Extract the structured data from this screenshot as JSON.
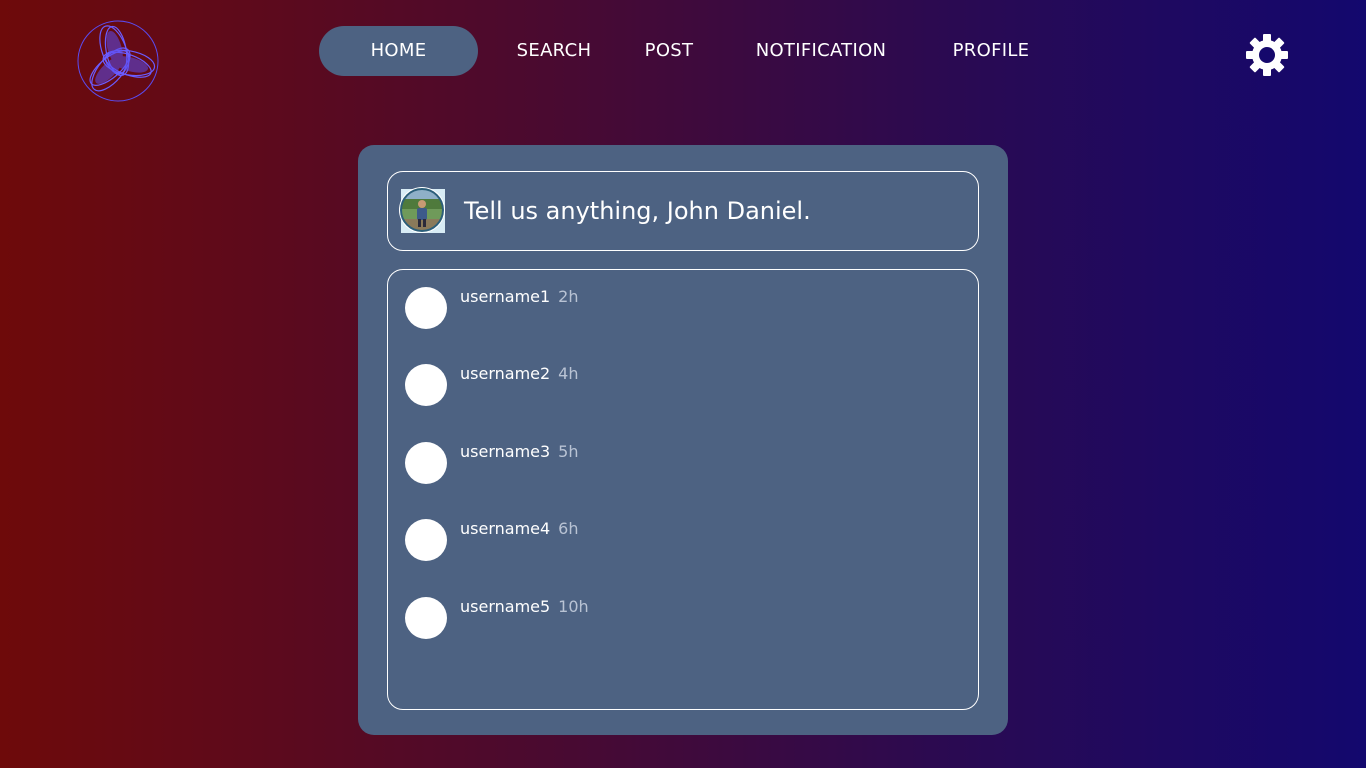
{
  "nav": {
    "items": [
      {
        "label": "HOME",
        "active": true
      },
      {
        "label": "SEARCH",
        "active": false
      },
      {
        "label": "POST",
        "active": false
      },
      {
        "label": "NOTIFICATION",
        "active": false
      },
      {
        "label": "PROFILE",
        "active": false
      }
    ]
  },
  "icons": {
    "logo": "spiral-logo-icon",
    "settings": "gear-icon",
    "user_avatar": "user-avatar-photo"
  },
  "composer": {
    "prompt": "Tell us anything, John Daniel."
  },
  "feed": {
    "items": [
      {
        "username": "username1",
        "time": "2h"
      },
      {
        "username": "username2",
        "time": "4h"
      },
      {
        "username": "username3",
        "time": "5h"
      },
      {
        "username": "username4",
        "time": "6h"
      },
      {
        "username": "username5",
        "time": "10h"
      }
    ]
  },
  "colors": {
    "accent": "#4d6282",
    "logo": "#5b4cf0",
    "timestamp": "#b9c3d4"
  }
}
